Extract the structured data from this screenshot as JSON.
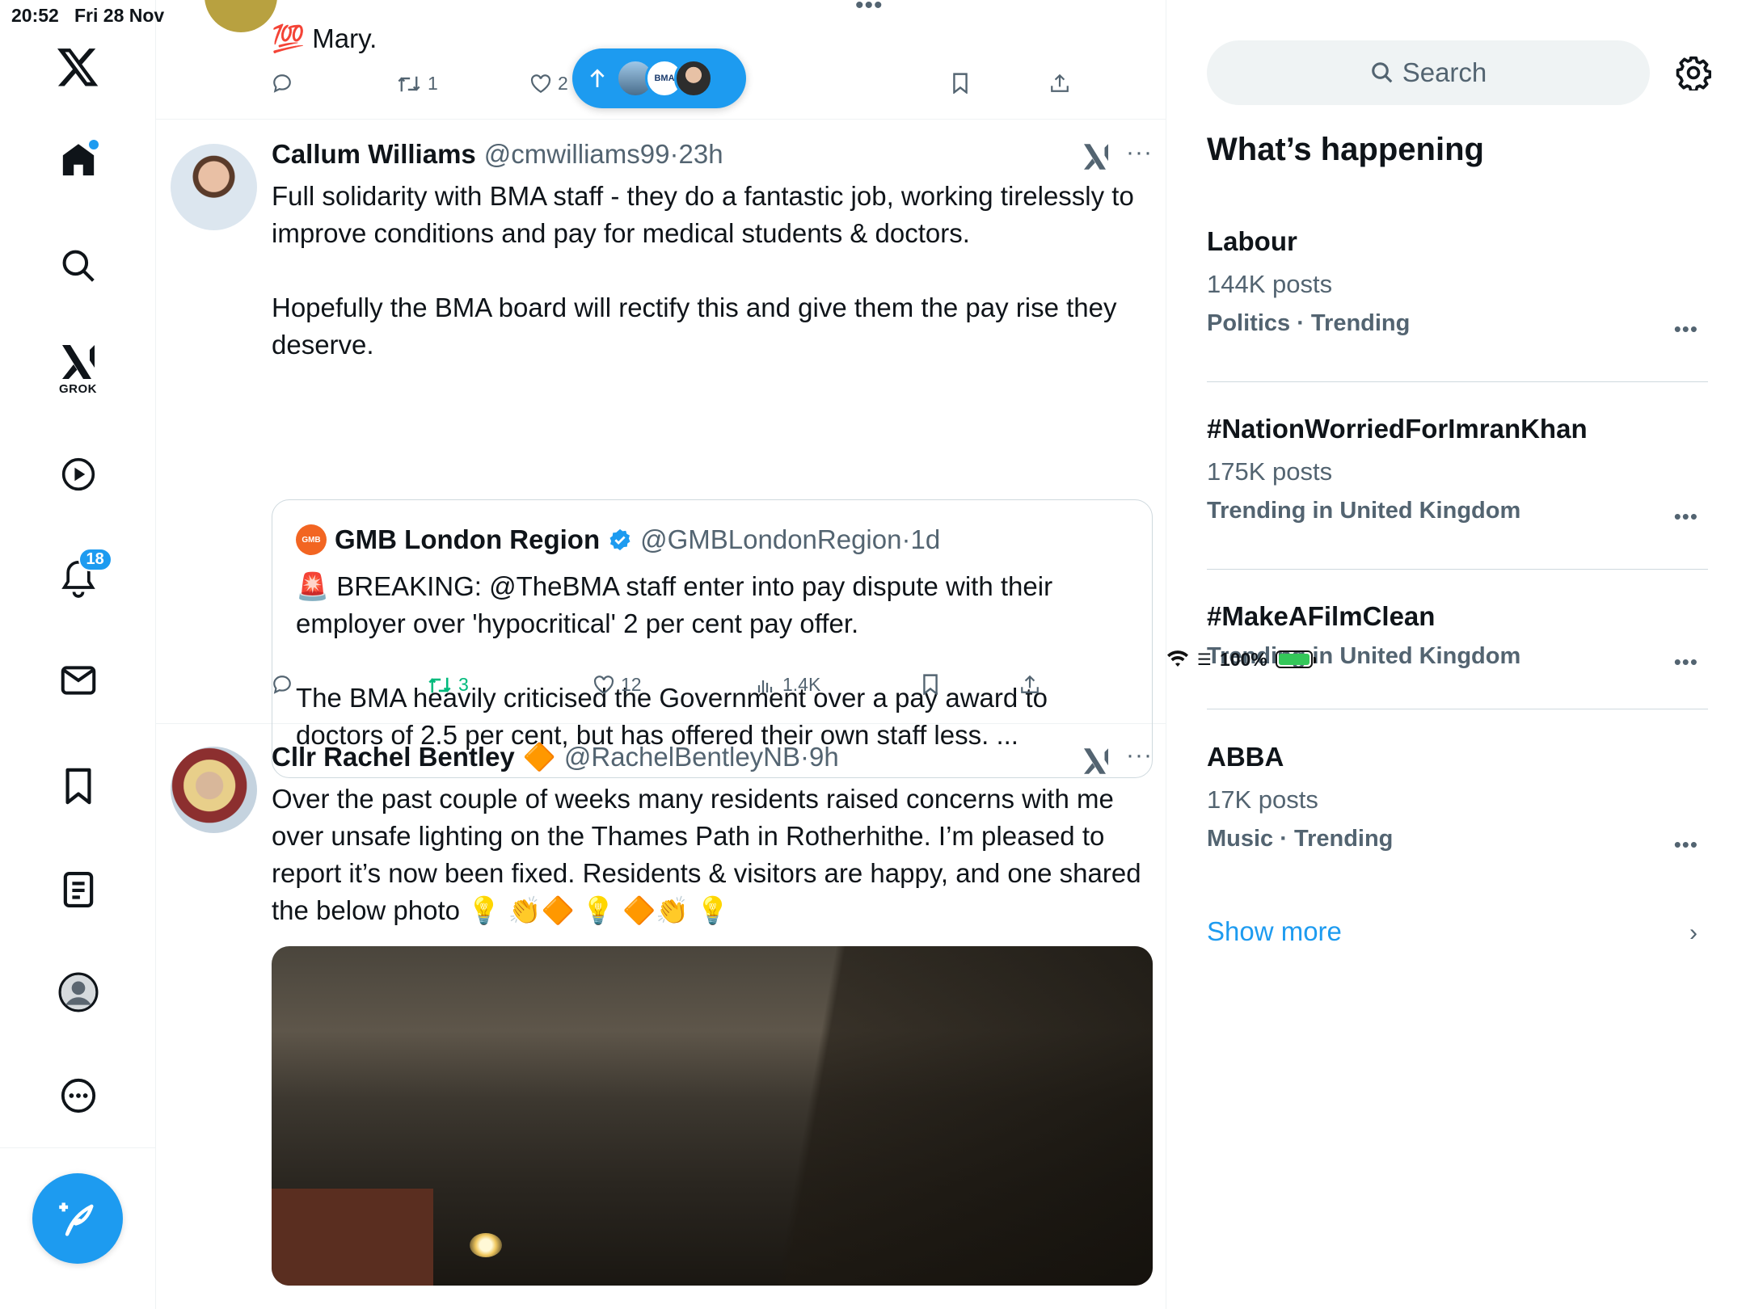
{
  "status": {
    "time": "20:52",
    "date": "Fri 28 Nov",
    "battery": "100%"
  },
  "sidebar": {
    "grok_label": "GROK",
    "notifications_count": "18"
  },
  "pill": {
    "label": "BMA"
  },
  "tweets": [
    {
      "text": "💯 Mary.",
      "retweets": "1",
      "likes": "2"
    },
    {
      "name": "Callum Williams",
      "handle": "@cmwilliams99",
      "time": "23h",
      "text_lines": [
        "Full solidarity with BMA staff - they do a fantastic job, working tirelessly to improve conditions and pay for medical students & doctors.",
        "Hopefully the BMA board will rectify this and give them the pay rise they deserve."
      ],
      "quote": {
        "avatar_label": "GMB",
        "name": "GMB London Region",
        "handle": "@GMBLondonRegion",
        "time": "1d",
        "text_lines": [
          "🚨 BREAKING: @TheBMA staff enter into pay dispute with their employer over 'hypocritical' 2 per cent pay offer.",
          "The BMA heavily criticised the Government over a pay award to doctors of 2.5 per cent, but has offered their own staff less. ..."
        ]
      },
      "retweets": "3",
      "likes": "12",
      "views": "1.4K"
    },
    {
      "name": "Cllr Rachel Bentley",
      "name_badge": "🔶",
      "handle": "@RachelBentleyNB",
      "time": "9h",
      "text": "Over the past couple of weeks many residents raised concerns with me over unsafe lighting on the Thames Path in Rotherhithe. I’m pleased to report it’s now been fixed. Residents & visitors are happy, and one shared the below photo 💡 👏🔶 💡 🔶👏 💡"
    }
  ],
  "right": {
    "search_placeholder": "Search",
    "title": "What’s happening",
    "trends": [
      {
        "name": "Labour",
        "posts": "144K posts",
        "context": "Politics · Trending"
      },
      {
        "name": "#NationWorriedForImranKhan",
        "posts": "175K posts",
        "context": "Trending in United Kingdom"
      },
      {
        "name": "#MakeAFilmClean",
        "posts": "",
        "context": "Trending in United Kingdom"
      },
      {
        "name": "ABBA",
        "posts": "17K posts",
        "context": "Music · Trending"
      }
    ],
    "show_more": "Show more"
  },
  "colors": {
    "accent": "#1d9bf0",
    "retweet_active": "#00ba7c",
    "secondary_text": "#536471"
  }
}
